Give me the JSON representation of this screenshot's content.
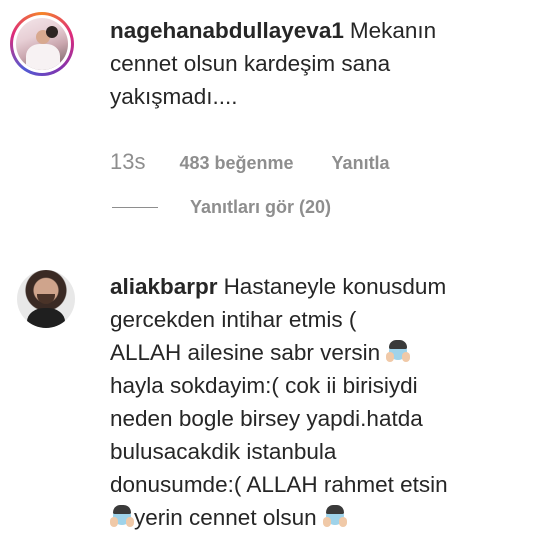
{
  "comments": [
    {
      "username": "nagehanabdullayeva1",
      "text_lines": [
        "Mekanın",
        "cennet olsun kardeşim sana",
        "yakışmadı...."
      ],
      "time": "13s",
      "likes": "483 beğenme",
      "reply_label": "Yanıtla",
      "view_replies": "Yanıtları gör (20)"
    },
    {
      "username": "aliakbarpr",
      "line1": "Hastaneyle konusdum",
      "line2": "gercekden intihar etmis (",
      "line3": "ALLAH ailesine sabr versin",
      "line4": "hayla sokdayim:( cok ii birisiydi",
      "line5": "neden bogle birsey yapdi.hatda",
      "line6": "bulusacakdik istanbula",
      "line7": "donusumde:( ALLAH rahmet etsin",
      "line8": "yerin cennet olsun",
      "emoji": "face-with-hand-over-mouth-icon"
    }
  ],
  "colors": {
    "text": "#262626",
    "muted": "#8e8e8e",
    "background": "#ffffff"
  }
}
